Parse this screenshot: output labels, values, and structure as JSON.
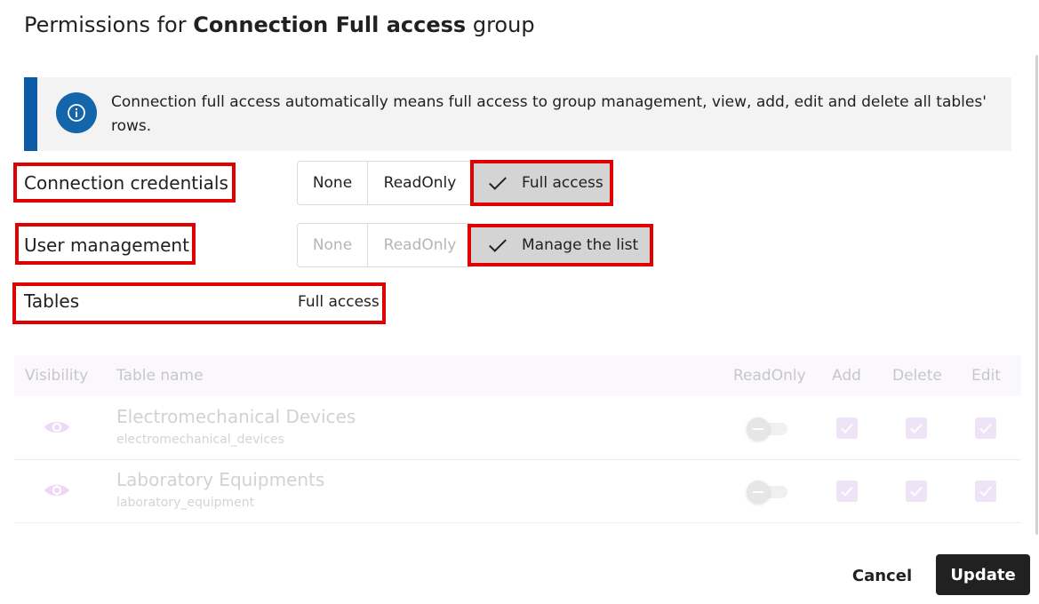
{
  "dialog": {
    "title_prefix": "Permissions for ",
    "title_group": "Connection Full access",
    "title_suffix": " group"
  },
  "info": {
    "icon": "info-icon",
    "text": "Connection full access automatically means full access to group management, view, add, edit and delete all tables' rows."
  },
  "connection_credentials": {
    "label": "Connection credentials",
    "options": [
      "None",
      "ReadOnly"
    ],
    "selected": "Full access"
  },
  "user_management": {
    "label": "User management",
    "options": [
      "None",
      "ReadOnly"
    ],
    "selected": "Manage the list"
  },
  "tables_access": {
    "label": "Tables",
    "value": "Full access"
  },
  "table": {
    "headers": {
      "visibility": "Visibility",
      "table_name": "Table name",
      "readonly": "ReadOnly",
      "add": "Add",
      "delete": "Delete",
      "edit": "Edit"
    },
    "rows": [
      {
        "title": "Electromechanical Devices",
        "name": "electromechanical_devices",
        "visible": true,
        "readonly": false,
        "add": true,
        "delete": true,
        "edit": true
      },
      {
        "title": "Laboratory Equipments",
        "name": "laboratory_equipment",
        "visible": true,
        "readonly": false,
        "add": true,
        "delete": true,
        "edit": true
      }
    ]
  },
  "actions": {
    "cancel": "Cancel",
    "update": "Update"
  },
  "colors": {
    "accent": "#0d5aa7",
    "highlight": "#e00000",
    "selected": "#d4d4d4",
    "primary_button": "#212121"
  }
}
